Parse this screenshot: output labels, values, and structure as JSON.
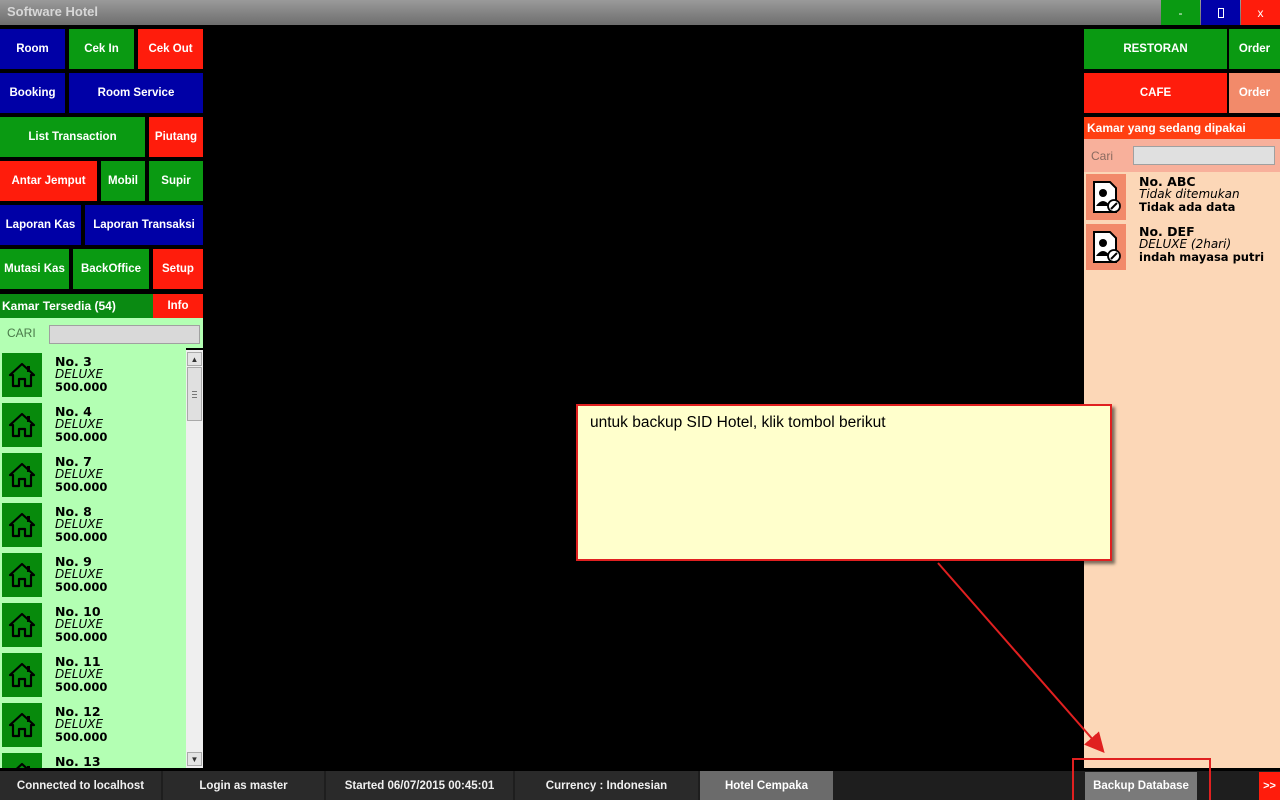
{
  "window": {
    "title": "Software  Hotel",
    "minimize": "-",
    "close": "x"
  },
  "menu": {
    "room": "Room",
    "cek_in": "Cek In",
    "cek_out": "Cek Out",
    "booking": "Booking",
    "room_service": "Room Service",
    "list_transaction": "List Transaction",
    "piutang": "Piutang",
    "antar_jemput": "Antar Jemput",
    "mobil": "Mobil",
    "supir": "Supir",
    "laporan_kas": "Laporan Kas",
    "laporan_transaksi": "Laporan Transaksi",
    "mutasi_kas": "Mutasi Kas",
    "backoffice": "BackOffice",
    "setup": "Setup"
  },
  "available": {
    "header": "Kamar Tersedia (54)",
    "info": "Info",
    "search_label": "CARI",
    "rooms": [
      {
        "no": "No. 3",
        "type": "DELUXE",
        "price": "500.000"
      },
      {
        "no": "No. 4",
        "type": "DELUXE",
        "price": "500.000"
      },
      {
        "no": "No. 7",
        "type": "DELUXE",
        "price": "500.000"
      },
      {
        "no": "No. 8",
        "type": "DELUXE",
        "price": "500.000"
      },
      {
        "no": "No. 9",
        "type": "DELUXE",
        "price": "500.000"
      },
      {
        "no": "No. 10",
        "type": "DELUXE",
        "price": "500.000"
      },
      {
        "no": "No. 11",
        "type": "DELUXE",
        "price": "500.000"
      },
      {
        "no": "No. 12",
        "type": "DELUXE",
        "price": "500.000"
      },
      {
        "no": "No. 13",
        "type": "",
        "price": ""
      }
    ]
  },
  "right": {
    "restoran": "RESTORAN",
    "order1": "Order",
    "cafe": "CAFE",
    "order2": "Order",
    "used_header": "Kamar yang sedang dipakai",
    "search_label": "Cari",
    "used_rooms": [
      {
        "no": "No. ABC",
        "sub": "Tidak ditemukan",
        "info": "Tidak ada data"
      },
      {
        "no": "No. DEF",
        "sub": "DELUXE (2hari)",
        "info": "indah mayasa putri"
      }
    ]
  },
  "callout": {
    "message": "untuk backup SID Hotel, klik tombol berikut"
  },
  "status": {
    "connected": "Connected to localhost",
    "login": "Login as master",
    "started": "Started 06/07/2015 00:45:01",
    "currency": "Currency : Indonesian",
    "hotel": "Hotel Cempaka",
    "backup": "Backup Database",
    "next": ">>"
  },
  "colors": {
    "blue": "#0000a6",
    "green": "#0a9a12",
    "red": "#ff1c0c",
    "salmon": "#f28a6a",
    "panel_green": "#b3ffb3",
    "panel_peach": "#fcd7b7"
  },
  "icons": {
    "room": "house-icon",
    "used_room": "guest-document-icon"
  }
}
